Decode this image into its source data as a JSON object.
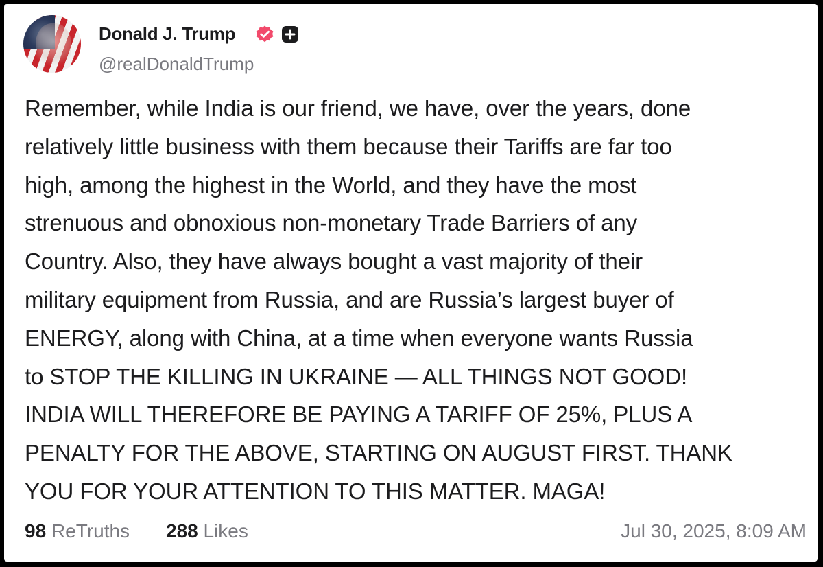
{
  "post": {
    "author": {
      "display_name": "Donald J. Trump",
      "handle": "@realDonaldTrump",
      "verified_badge_icon": "verified-check-icon",
      "plus_badge_icon": "plus-square-icon",
      "verified_color": "#f24a6b"
    },
    "text": "Remember, while India is our friend, we have, over the years, done\nrelatively little business with them because their Tariffs are far too\nhigh, among the highest in the World, and they have the most\nstrenuous and obnoxious non-monetary Trade Barriers of any\nCountry. Also, they have always bought a vast majority of their\nmilitary equipment from Russia, and are Russia’s largest buyer of\nENERGY, along with China, at a time when everyone wants Russia\nto STOP THE KILLING IN UKRAINE — ALL THINGS NOT GOOD!\nINDIA WILL THEREFORE BE PAYING A TARIFF OF 25%, PLUS A\nPENALTY FOR THE ABOVE, STARTING ON AUGUST FIRST. THANK\nYOU FOR YOUR ATTENTION TO THIS MATTER. MAGA!",
    "stats": {
      "retruths_count": "98",
      "retruths_label": "ReTruths",
      "likes_count": "288",
      "likes_label": "Likes"
    },
    "timestamp": "Jul 30, 2025, 8:09 AM"
  }
}
